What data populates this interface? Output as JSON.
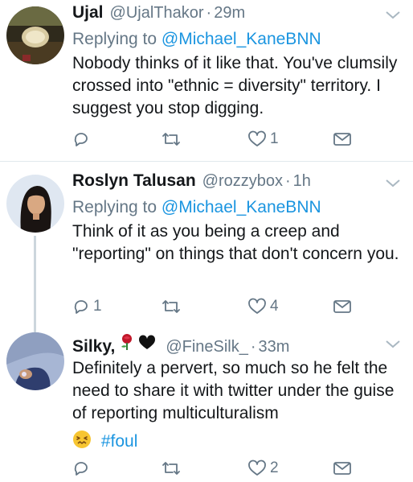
{
  "colors": {
    "accent": "#1b95e0",
    "muted": "#657786",
    "text": "#14171a",
    "divider": "#e1e8ed"
  },
  "tweets": [
    {
      "name": "Ujal",
      "handle": "@UjalThakor",
      "time": "29m",
      "replying_prefix": "Replying to",
      "replying_to": "@Michael_KaneBNN",
      "text": "Nobody thinks of it like that. You've clumsily crossed into \"ethnic = diversity\" territory. I suggest you stop digging.",
      "reply_count": "",
      "retweet_count": "",
      "like_count": "1"
    },
    {
      "name": "Roslyn Talusan",
      "handle": "@rozzybox",
      "time": "1h",
      "replying_prefix": "Replying to",
      "replying_to": "@Michael_KaneBNN",
      "text": "Think of it as you being a creep and \"reporting\" on things that don't concern you.",
      "reply_count": "1",
      "retweet_count": "",
      "like_count": "4"
    },
    {
      "name": "Silky,",
      "name_icons": [
        "rose-emoji",
        "black-heart-emoji"
      ],
      "handle": "@FineSilk_",
      "time": "33m",
      "text": "Definitely a pervert, so much so he felt the need to share it with twitter under the guise of reporting multiculturalism",
      "hashtag_icon": "confounded-face-emoji",
      "hashtag": "#foul",
      "reply_count": "",
      "retweet_count": "",
      "like_count": "2"
    }
  ],
  "dot": "·"
}
